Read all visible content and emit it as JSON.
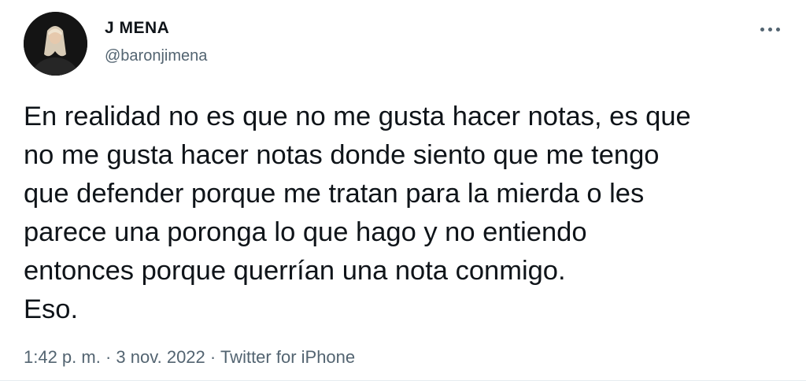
{
  "author": {
    "display_name": "J MENA",
    "handle": "@baronjimena",
    "avatar_icon": "profile-photo"
  },
  "more_icon": "more-options-icon",
  "tweet": {
    "lines": [
      "En realidad no es que no me gusta hacer notas, es que",
      "no me gusta hacer notas donde siento que me tengo",
      "que defender porque me tratan para la mierda o les",
      "parece una poronga lo que hago y no entiendo",
      "entonces porque querrían una nota conmigo.",
      "Eso."
    ]
  },
  "meta": {
    "time": "1:42 p. m.",
    "date": "3 nov. 2022",
    "source": "Twitter for iPhone",
    "separator": "·"
  },
  "colors": {
    "text": "#0f1419",
    "secondary": "#536471",
    "background": "#ffffff"
  }
}
